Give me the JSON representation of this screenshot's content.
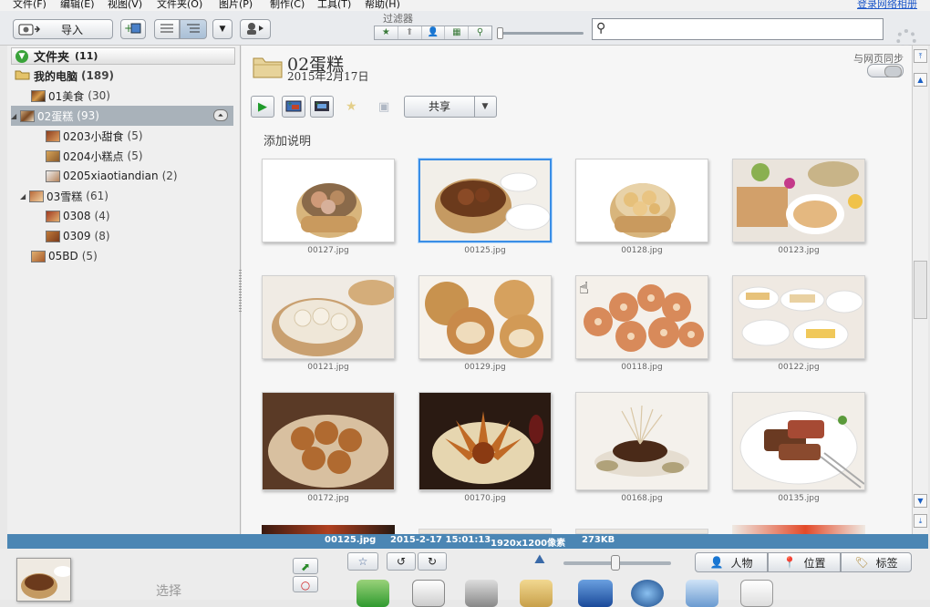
{
  "menu": [
    "文件(F)",
    "编辑(E)",
    "视图(V)",
    "文件夹(O)",
    "图片(P)",
    "制作(C)",
    "工具(T)",
    "帮助(H)"
  ],
  "menu_login": "登录网络相册",
  "toolbar": {
    "import_label": "导入",
    "filter_label": "过滤器",
    "search_placeholder": ""
  },
  "left": {
    "folders_header": "文件夹",
    "folders_count": "(11)",
    "tree": [
      {
        "label": "我的电脑",
        "count": "(189)",
        "bold": true
      },
      {
        "label": "01美食",
        "count": "(30)"
      },
      {
        "label": "02蛋糕",
        "count": "(93)",
        "selected": true
      },
      {
        "label": "0203小甜食",
        "count": "(5)"
      },
      {
        "label": "0204小糕点",
        "count": "(5)"
      },
      {
        "label": "0205xiaotiandian",
        "count": "(2)"
      },
      {
        "label": "03雪糕",
        "count": "(61)"
      },
      {
        "label": "0308",
        "count": "(4)"
      },
      {
        "label": "0309",
        "count": "(8)"
      },
      {
        "label": "05BD",
        "count": "(5)"
      }
    ]
  },
  "main": {
    "folder_title": "02蛋糕",
    "folder_date": "2015年2月17日",
    "sync_label": "与网页同步",
    "share_label": "共享",
    "add_caption": "添加说明",
    "photos": [
      {
        "name": "00127.jpg"
      },
      {
        "name": "00125.jpg",
        "selected": true
      },
      {
        "name": "00128.jpg"
      },
      {
        "name": "00123.jpg"
      },
      {
        "name": "00121.jpg"
      },
      {
        "name": "00129.jpg"
      },
      {
        "name": "00118.jpg"
      },
      {
        "name": "00122.jpg"
      },
      {
        "name": "00172.jpg"
      },
      {
        "name": "00170.jpg"
      },
      {
        "name": "00168.jpg"
      },
      {
        "name": "00135.jpg"
      }
    ]
  },
  "status": {
    "file": "00125.jpg",
    "date": "2015-2-17 15:01:13",
    "dims": "1920x1200像素",
    "size": "273KB"
  },
  "bottom": {
    "select_label": "选择",
    "people_label": "人物",
    "location_label": "位置",
    "tags_label": "标签"
  }
}
